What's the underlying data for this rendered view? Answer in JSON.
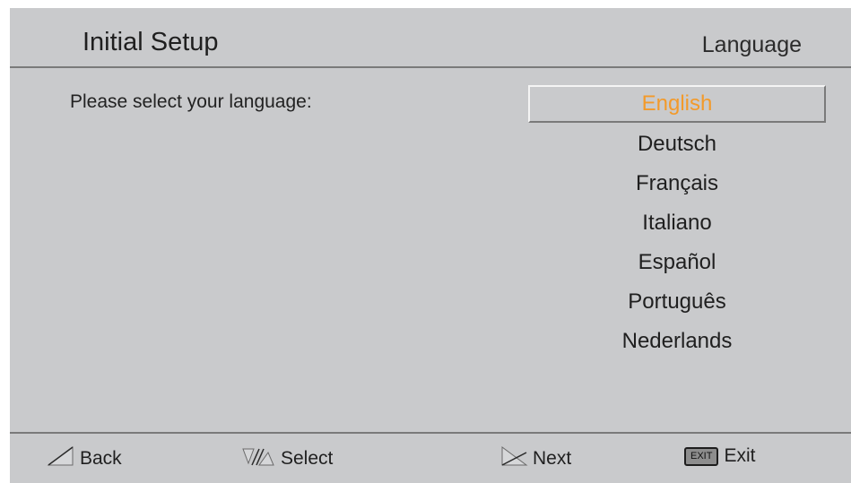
{
  "header": {
    "title": "Initial Setup",
    "section": "Language"
  },
  "main": {
    "prompt": "Please select your language:",
    "selected_index": 0,
    "languages": [
      {
        "label": "English"
      },
      {
        "label": "Deutsch"
      },
      {
        "label": "Français"
      },
      {
        "label": "Italiano"
      },
      {
        "label": "Español"
      },
      {
        "label": "Português"
      },
      {
        "label": "Nederlands"
      }
    ]
  },
  "footer": {
    "back_label": "Back",
    "select_label": "Select",
    "next_label": "Next",
    "exit_key_label": "EXIT",
    "exit_label": "Exit"
  },
  "colors": {
    "background": "#c9cacc",
    "selected_text": "#f39a2a",
    "text": "#1f1f1f"
  }
}
